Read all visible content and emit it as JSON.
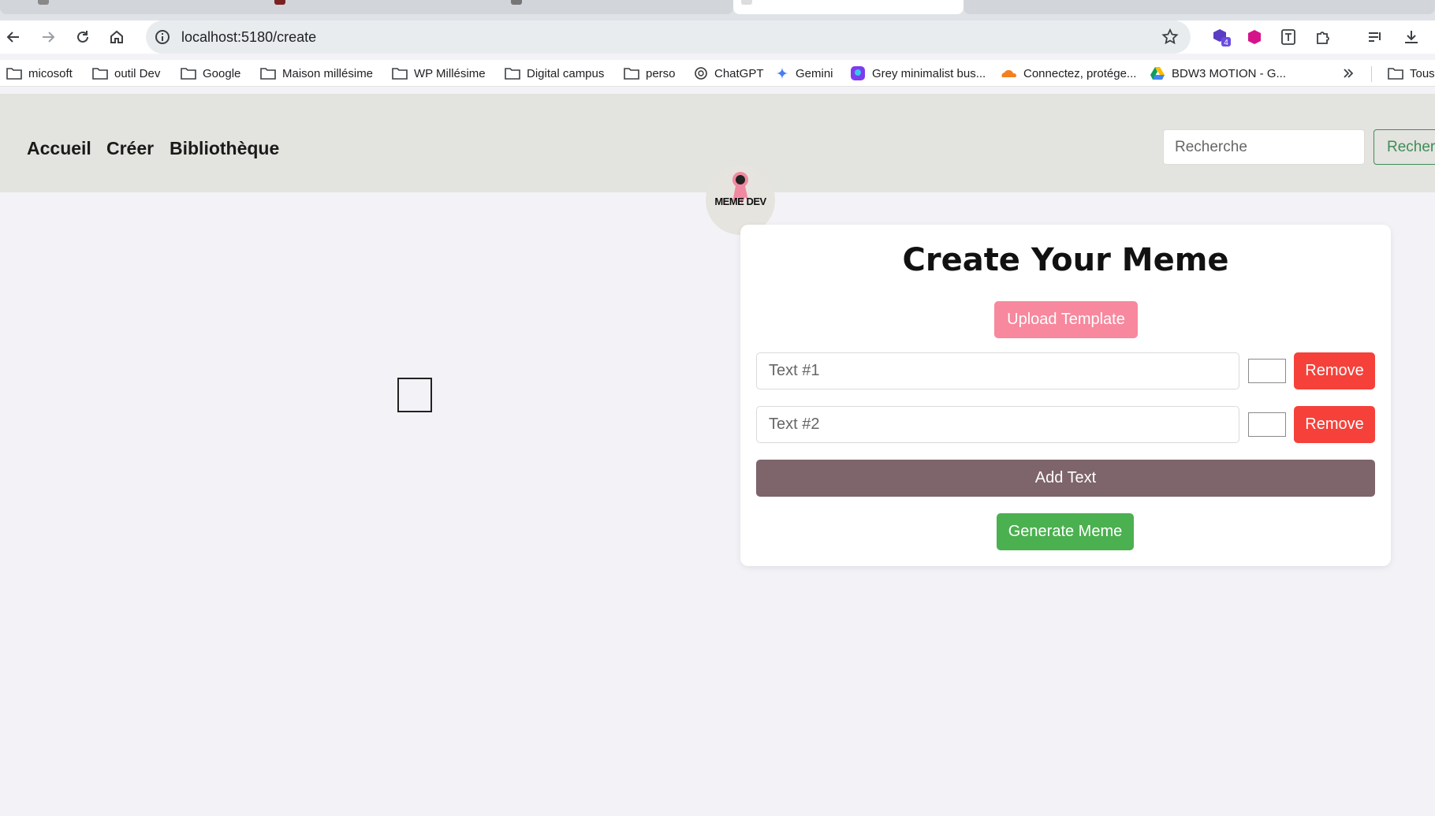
{
  "browser": {
    "url": "localhost:5180/create",
    "extension_badge": "4"
  },
  "bookmarks": [
    {
      "label": "micosoft",
      "icon": "folder-icon"
    },
    {
      "label": "outil Dev",
      "icon": "folder-icon"
    },
    {
      "label": "Google",
      "icon": "folder-icon"
    },
    {
      "label": "Maison millésime",
      "icon": "folder-icon"
    },
    {
      "label": "WP Millésime",
      "icon": "folder-icon"
    },
    {
      "label": "Digital campus",
      "icon": "folder-icon"
    },
    {
      "label": "perso",
      "icon": "folder-icon"
    },
    {
      "label": "ChatGPT",
      "icon": "chatgpt-icon"
    },
    {
      "label": "Gemini",
      "icon": "gemini-icon"
    },
    {
      "label": "Grey minimalist bus...",
      "icon": "canva-icon"
    },
    {
      "label": "Connectez, protége...",
      "icon": "cloudflare-icon"
    },
    {
      "label": "BDW3 MOTION - G...",
      "icon": "drive-icon"
    }
  ],
  "bookmarks_more": "Tous",
  "header": {
    "nav": [
      "Accueil",
      "Créer",
      "Bibliothèque"
    ],
    "search_placeholder": "Recherche",
    "search_button": "Recher"
  },
  "logo_text": "MEME DEV",
  "card": {
    "title": "Create Your Meme",
    "upload_label": "Upload Template",
    "texts": [
      {
        "placeholder": "Text #1",
        "remove": "Remove"
      },
      {
        "placeholder": "Text #2",
        "remove": "Remove"
      }
    ],
    "add_label": "Add Text",
    "generate_label": "Generate Meme"
  },
  "colors": {
    "upload": "#f7889e",
    "remove": "#f5413a",
    "add": "#7e646b",
    "generate": "#4bb04f",
    "header_bg": "#e3e3df"
  }
}
